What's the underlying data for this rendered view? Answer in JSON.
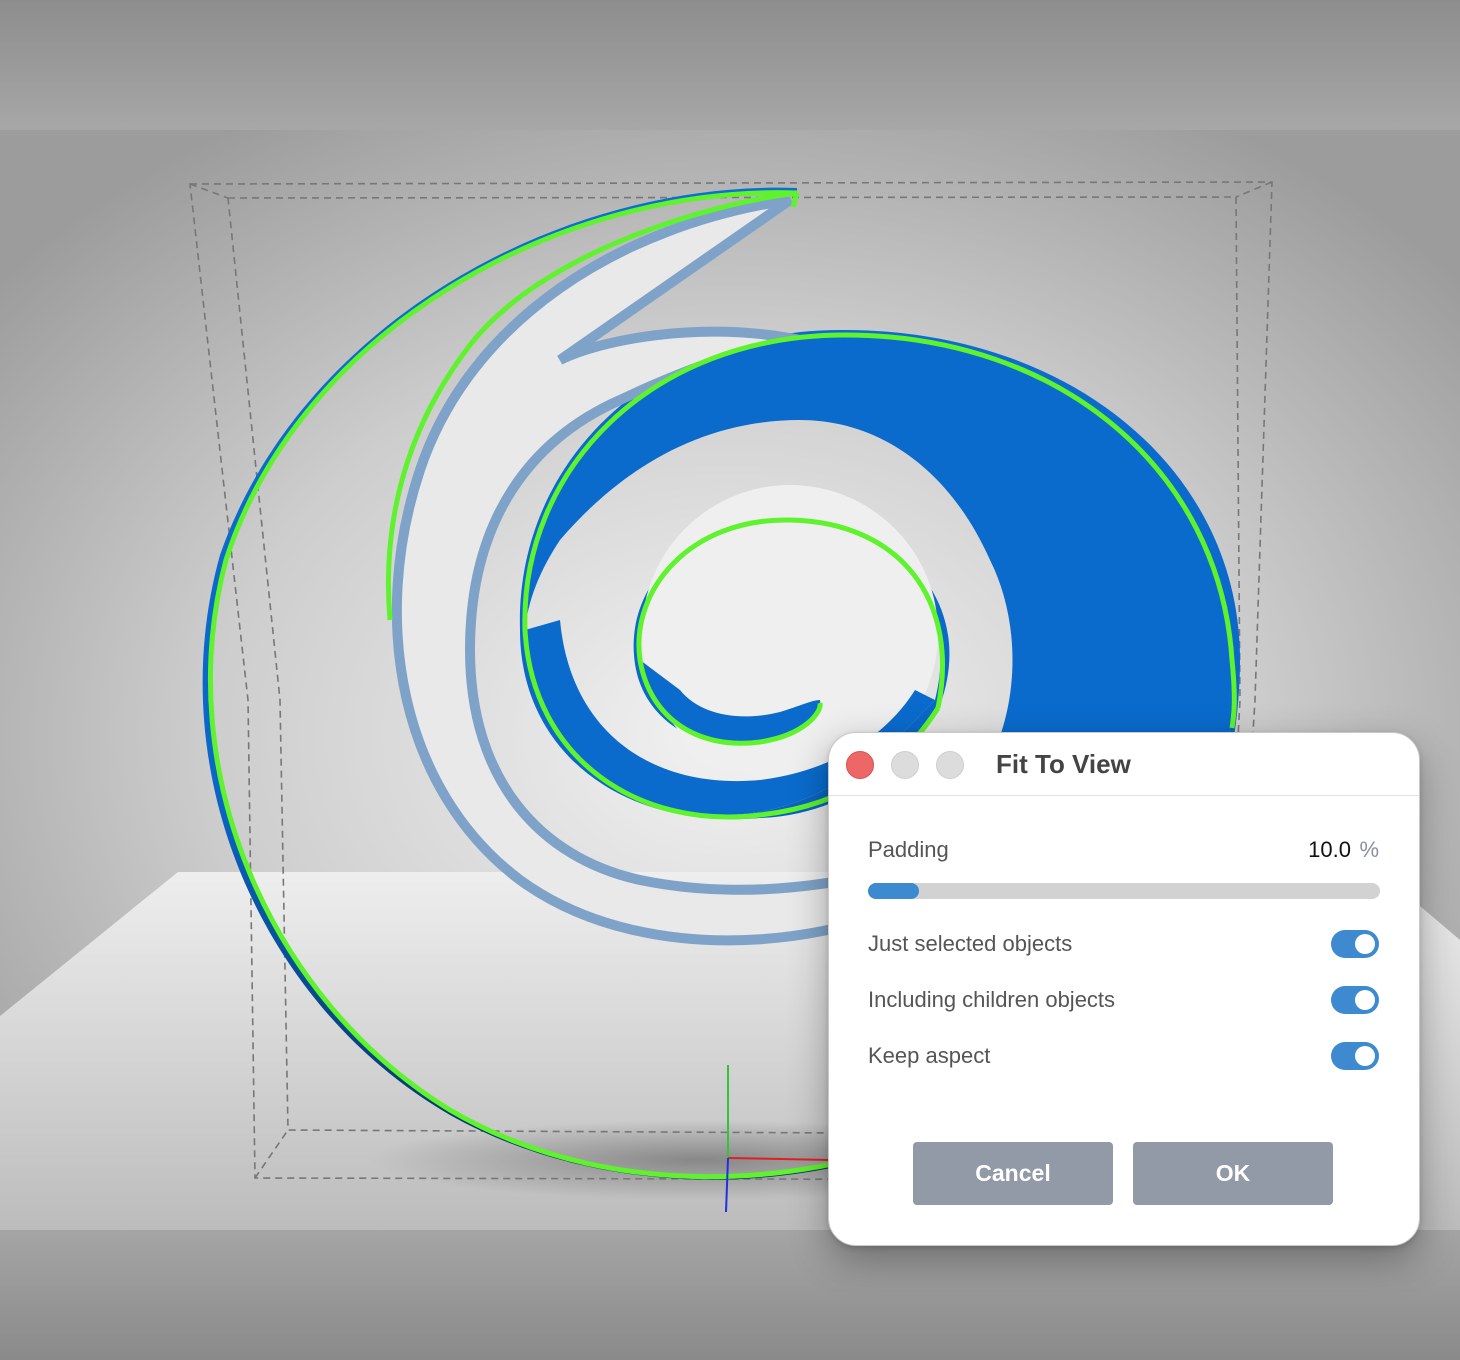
{
  "colors": {
    "accent": "#3d8ad0",
    "model_blue": "#0a6bcd",
    "outline_green": "#5ef32c",
    "close_red": "#ec6765",
    "button_gray": "#9299a7"
  },
  "viewport": {
    "object": "spiral-model",
    "selection_outline": "green",
    "bounding_box": "dashed"
  },
  "dialog": {
    "title": "Fit To View",
    "padding": {
      "label": "Padding",
      "value": "10.0",
      "unit": "%",
      "slider_fraction": 0.1
    },
    "options": [
      {
        "label": "Just selected objects",
        "enabled": true
      },
      {
        "label": "Including children objects",
        "enabled": true
      },
      {
        "label": "Keep aspect",
        "enabled": true
      }
    ],
    "buttons": {
      "cancel": "Cancel",
      "ok": "OK"
    }
  }
}
